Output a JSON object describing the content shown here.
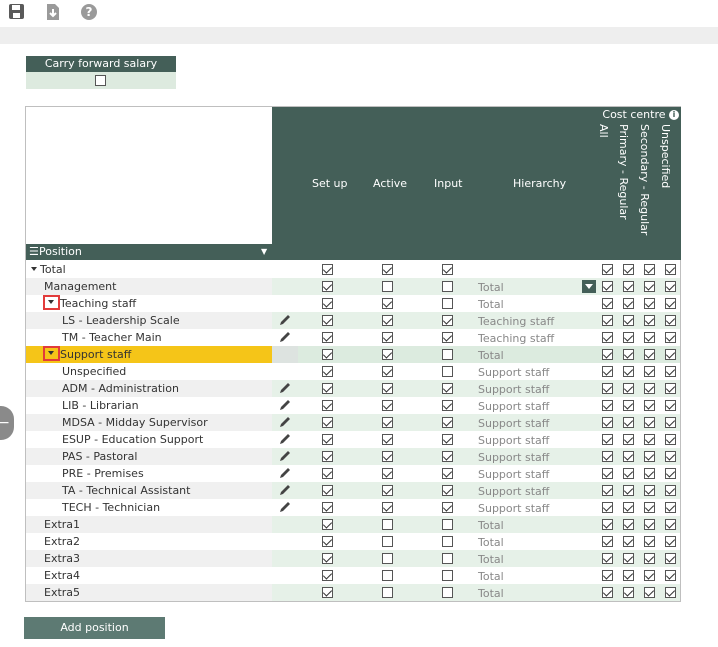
{
  "toolbar": {
    "icons": [
      "save-icon",
      "download-icon",
      "help-icon"
    ]
  },
  "carry_forward": {
    "label": "Carry forward salary",
    "checked": false
  },
  "grid": {
    "columns": {
      "setup": "Set up",
      "active": "Active",
      "input": "Input",
      "hierarchy": "Hierarchy"
    },
    "cost_centre": {
      "title": "Cost centre",
      "columns": [
        "All",
        "Primary - Regular",
        "Secondary - Regular",
        "Unspecified"
      ]
    },
    "position_header": "Position",
    "rows": [
      {
        "name": "Total",
        "hier": "",
        "setup": true,
        "active": true,
        "input": true,
        "cc": [
          true,
          true,
          true,
          true
        ]
      },
      {
        "name": "Management",
        "hier": "Total",
        "setup": true,
        "active": false,
        "input": false,
        "cc": [
          true,
          true,
          true,
          true
        ]
      },
      {
        "name": "Teaching staff",
        "hier": "Total",
        "setup": true,
        "active": true,
        "input": false,
        "cc": [
          true,
          true,
          true,
          true
        ]
      },
      {
        "name": "LS - Leadership Scale",
        "hier": "Teaching staff",
        "setup": true,
        "active": true,
        "input": true,
        "cc": [
          true,
          true,
          true,
          true
        ]
      },
      {
        "name": "TM - Teacher Main",
        "hier": "Teaching staff",
        "setup": true,
        "active": true,
        "input": true,
        "cc": [
          true,
          true,
          true,
          true
        ]
      },
      {
        "name": "Support staff",
        "hier": "Total",
        "setup": true,
        "active": true,
        "input": false,
        "cc": [
          true,
          true,
          true,
          true
        ]
      },
      {
        "name": "Unspecified",
        "hier": "Support staff",
        "setup": true,
        "active": true,
        "input": false,
        "cc": [
          true,
          true,
          true,
          true
        ]
      },
      {
        "name": "ADM - Administration",
        "hier": "Support staff",
        "setup": true,
        "active": true,
        "input": true,
        "cc": [
          true,
          true,
          true,
          true
        ]
      },
      {
        "name": "LIB - Librarian",
        "hier": "Support staff",
        "setup": true,
        "active": true,
        "input": true,
        "cc": [
          true,
          true,
          true,
          true
        ]
      },
      {
        "name": "MDSA - Midday Supervisor",
        "hier": "Support staff",
        "setup": true,
        "active": true,
        "input": true,
        "cc": [
          true,
          true,
          true,
          true
        ]
      },
      {
        "name": "ESUP - Education Support",
        "hier": "Support staff",
        "setup": true,
        "active": true,
        "input": true,
        "cc": [
          true,
          true,
          true,
          true
        ]
      },
      {
        "name": "PAS - Pastoral",
        "hier": "Support staff",
        "setup": true,
        "active": true,
        "input": true,
        "cc": [
          true,
          true,
          true,
          true
        ]
      },
      {
        "name": "PRE - Premises",
        "hier": "Support staff",
        "setup": true,
        "active": true,
        "input": true,
        "cc": [
          true,
          true,
          true,
          true
        ]
      },
      {
        "name": "TA - Technical Assistant",
        "hier": "Support staff",
        "setup": true,
        "active": true,
        "input": true,
        "cc": [
          true,
          true,
          true,
          true
        ]
      },
      {
        "name": "TECH - Technician",
        "hier": "Support staff",
        "setup": true,
        "active": true,
        "input": true,
        "cc": [
          true,
          true,
          true,
          true
        ]
      },
      {
        "name": "Extra1",
        "hier": "Total",
        "setup": true,
        "active": false,
        "input": false,
        "cc": [
          true,
          true,
          true,
          true
        ]
      },
      {
        "name": "Extra2",
        "hier": "Total",
        "setup": true,
        "active": false,
        "input": false,
        "cc": [
          true,
          true,
          true,
          true
        ]
      },
      {
        "name": "Extra3",
        "hier": "Total",
        "setup": true,
        "active": false,
        "input": false,
        "cc": [
          true,
          true,
          true,
          true
        ]
      },
      {
        "name": "Extra4",
        "hier": "Total",
        "setup": true,
        "active": false,
        "input": false,
        "cc": [
          true,
          true,
          true,
          true
        ]
      },
      {
        "name": "Extra5",
        "hier": "Total",
        "setup": true,
        "active": false,
        "input": false,
        "cc": [
          true,
          true,
          true,
          true
        ]
      }
    ]
  },
  "add_position": "Add position",
  "colors": {
    "header": "#445f58",
    "row_alt": "#dcebdf",
    "highlight": "#f5c518"
  }
}
